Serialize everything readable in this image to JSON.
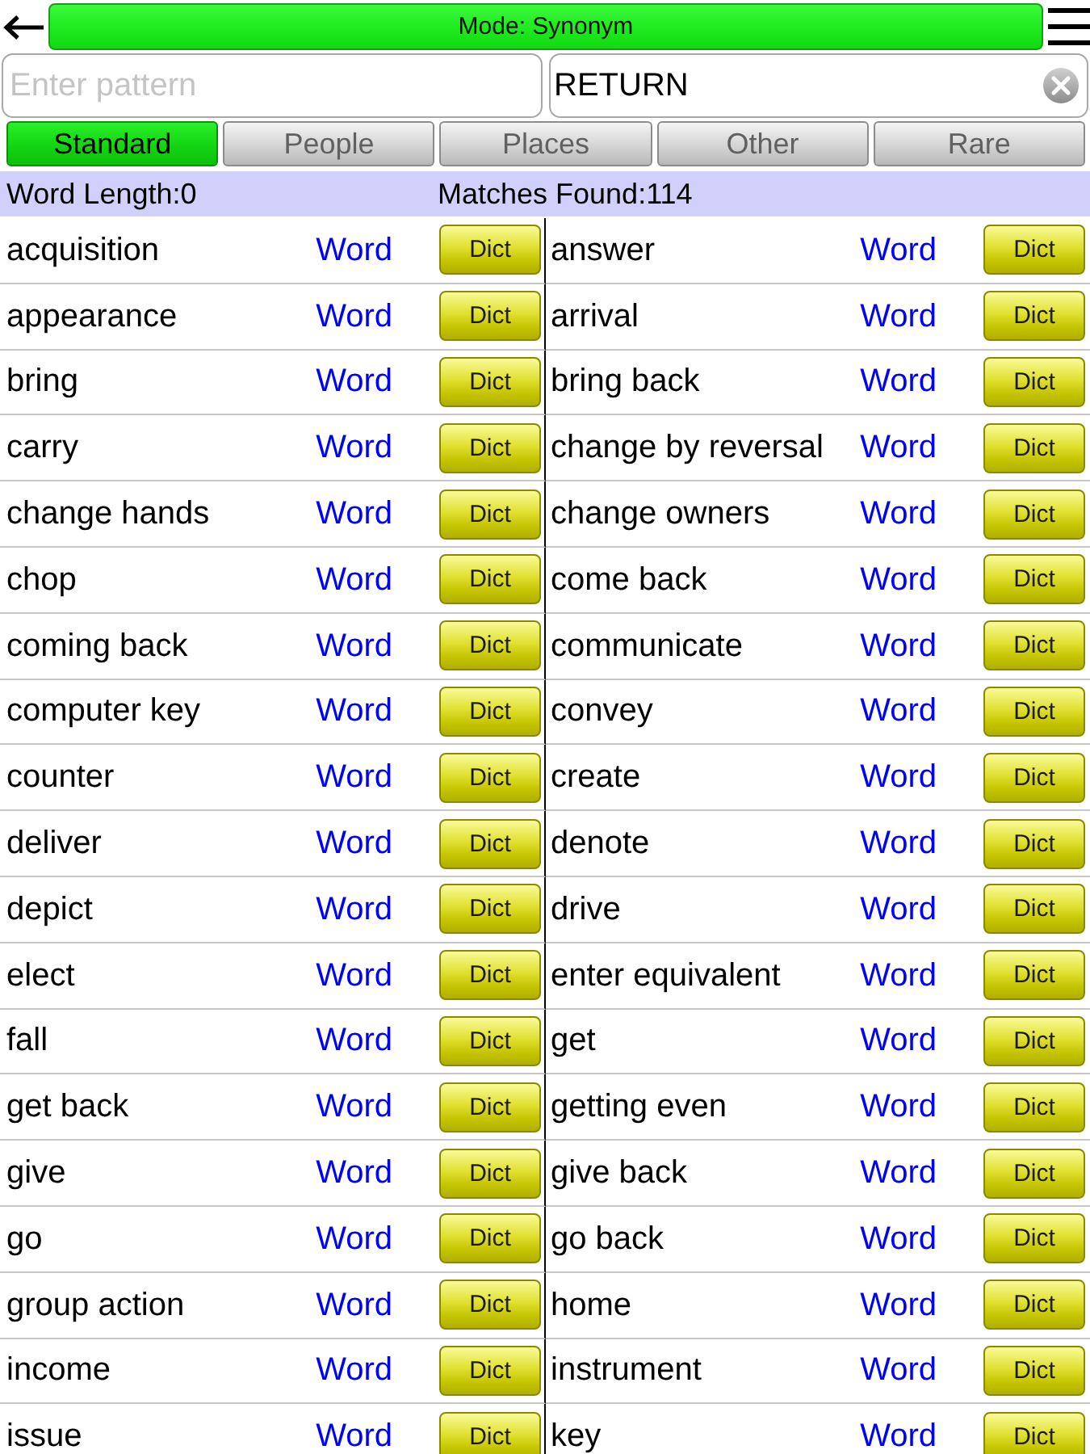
{
  "header": {
    "mode_label": "Mode: Synonym"
  },
  "pattern_field": {
    "placeholder": "Enter pattern"
  },
  "search_field": {
    "value": "RETURN"
  },
  "tabs": [
    {
      "label": "Standard",
      "selected": true
    },
    {
      "label": "People",
      "selected": false
    },
    {
      "label": "Places",
      "selected": false
    },
    {
      "label": "Other",
      "selected": false
    },
    {
      "label": "Rare",
      "selected": false
    }
  ],
  "status_bar": {
    "word_length": "Word Length:0",
    "matches": "Matches Found:114"
  },
  "results": [
    {
      "word": "acquisition",
      "link": "Word",
      "button": "Dict"
    },
    {
      "word": "answer",
      "link": "Word",
      "button": "Dict"
    },
    {
      "word": "appearance",
      "link": "Word",
      "button": "Dict"
    },
    {
      "word": "arrival",
      "link": "Word",
      "button": "Dict"
    },
    {
      "word": "bring",
      "link": "Word",
      "button": "Dict"
    },
    {
      "word": "bring back",
      "link": "Word",
      "button": "Dict"
    },
    {
      "word": "carry",
      "link": "Word",
      "button": "Dict"
    },
    {
      "word": "change by reversal",
      "link": "Word",
      "button": "Dict"
    },
    {
      "word": "change hands",
      "link": "Word",
      "button": "Dict"
    },
    {
      "word": "change owners",
      "link": "Word",
      "button": "Dict"
    },
    {
      "word": "chop",
      "link": "Word",
      "button": "Dict"
    },
    {
      "word": "come back",
      "link": "Word",
      "button": "Dict"
    },
    {
      "word": "coming back",
      "link": "Word",
      "button": "Dict"
    },
    {
      "word": "communicate",
      "link": "Word",
      "button": "Dict"
    },
    {
      "word": "computer key",
      "link": "Word",
      "button": "Dict"
    },
    {
      "word": "convey",
      "link": "Word",
      "button": "Dict"
    },
    {
      "word": "counter",
      "link": "Word",
      "button": "Dict"
    },
    {
      "word": "create",
      "link": "Word",
      "button": "Dict"
    },
    {
      "word": "deliver",
      "link": "Word",
      "button": "Dict"
    },
    {
      "word": "denote",
      "link": "Word",
      "button": "Dict"
    },
    {
      "word": "depict",
      "link": "Word",
      "button": "Dict"
    },
    {
      "word": "drive",
      "link": "Word",
      "button": "Dict"
    },
    {
      "word": "elect",
      "link": "Word",
      "button": "Dict"
    },
    {
      "word": "enter equivalent",
      "link": "Word",
      "button": "Dict"
    },
    {
      "word": "fall",
      "link": "Word",
      "button": "Dict"
    },
    {
      "word": "get",
      "link": "Word",
      "button": "Dict"
    },
    {
      "word": "get back",
      "link": "Word",
      "button": "Dict"
    },
    {
      "word": "getting even",
      "link": "Word",
      "button": "Dict"
    },
    {
      "word": "give",
      "link": "Word",
      "button": "Dict"
    },
    {
      "word": "give back",
      "link": "Word",
      "button": "Dict"
    },
    {
      "word": "go",
      "link": "Word",
      "button": "Dict"
    },
    {
      "word": "go back",
      "link": "Word",
      "button": "Dict"
    },
    {
      "word": "group action",
      "link": "Word",
      "button": "Dict"
    },
    {
      "word": "home",
      "link": "Word",
      "button": "Dict"
    },
    {
      "word": "income",
      "link": "Word",
      "button": "Dict"
    },
    {
      "word": "instrument",
      "link": "Word",
      "button": "Dict"
    },
    {
      "word": "issue",
      "link": "Word",
      "button": "Dict"
    },
    {
      "word": "key",
      "link": "Word",
      "button": "Dict"
    }
  ]
}
